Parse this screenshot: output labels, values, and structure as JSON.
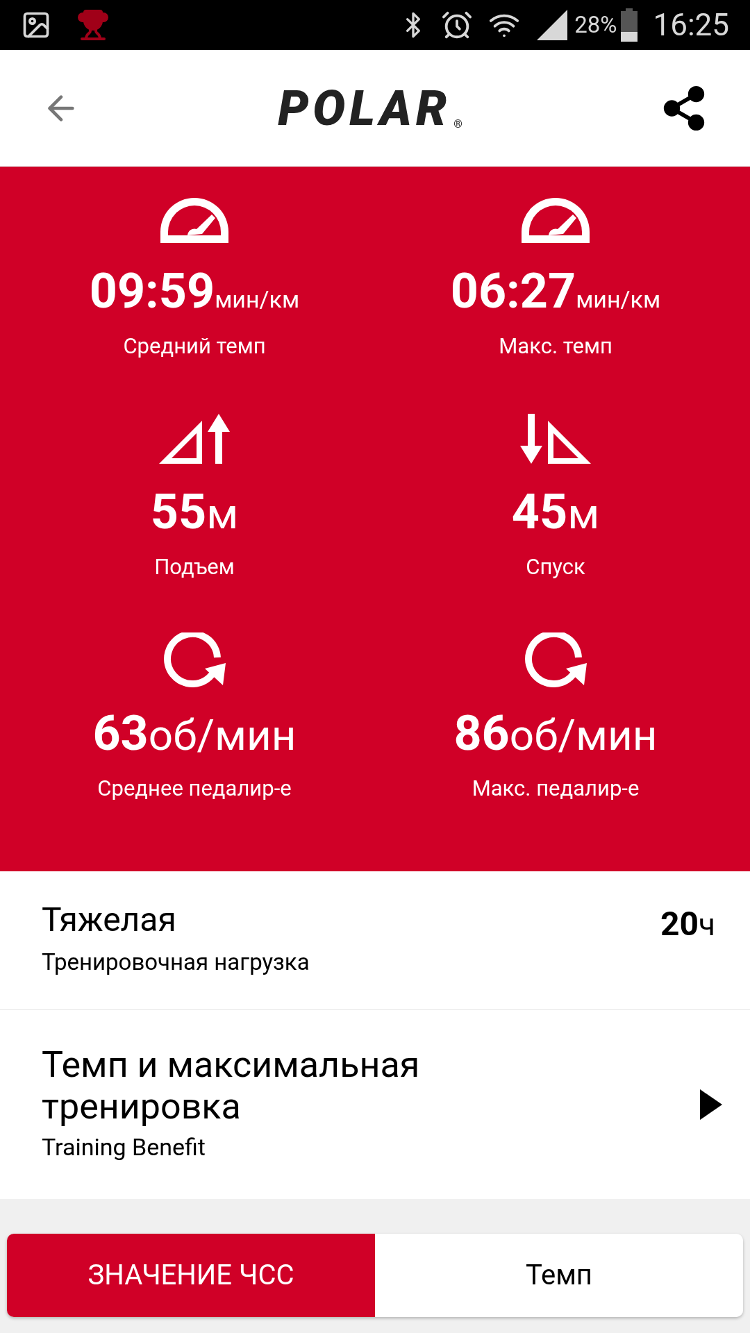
{
  "status_bar": {
    "battery": "28%",
    "time": "16:25"
  },
  "header": {
    "logo": "POLAR",
    "logo_mark": "®"
  },
  "stats": [
    {
      "kind": "speedometer",
      "value": "09:59",
      "unit": "мин/км",
      "label": "Средний темп"
    },
    {
      "kind": "speedometer",
      "value": "06:27",
      "unit": "мин/км",
      "label": "Макс. темп"
    },
    {
      "kind": "ascent",
      "value": "55",
      "unit": "м",
      "label": "Подъем"
    },
    {
      "kind": "descent",
      "value": "45",
      "unit": "м",
      "label": "Спуск"
    },
    {
      "kind": "cadence",
      "value": "63",
      "unit": "об/мин",
      "label": "Среднее педалир-е"
    },
    {
      "kind": "cadence",
      "value": "86",
      "unit": "об/мин",
      "label": "Макс. педалир-е"
    }
  ],
  "training_load": {
    "title": "Тяжелая",
    "subtitle": "Тренировочная нагрузка",
    "value": "20",
    "unit": "ч"
  },
  "training_benefit": {
    "title": "Темп и максимальная тренировка",
    "subtitle": "Training Benefit"
  },
  "tabs": [
    {
      "label": "ЗНАЧЕНИЕ ЧСС",
      "selected": true
    },
    {
      "label": "Темп",
      "selected": false
    }
  ]
}
